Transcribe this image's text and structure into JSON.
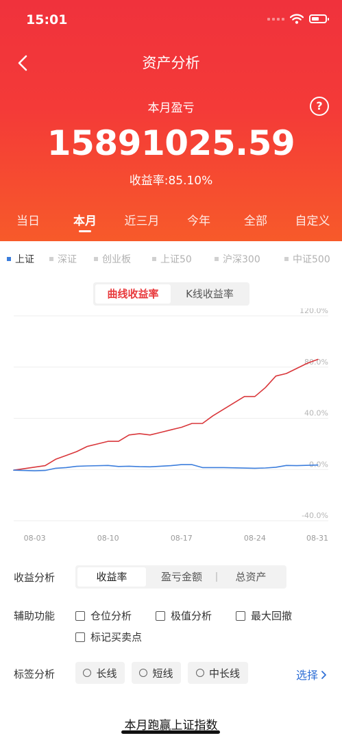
{
  "status_bar": {
    "time": "15:01"
  },
  "header": {
    "title": "资产分析"
  },
  "summary": {
    "label": "本月盈亏",
    "amount": "15891025.59",
    "rate_label": "收益率:",
    "rate_value": "85.10%",
    "help_glyph": "?"
  },
  "periods": [
    {
      "label": "当日",
      "active": false
    },
    {
      "label": "本月",
      "active": true
    },
    {
      "label": "近三月",
      "active": false
    },
    {
      "label": "今年",
      "active": false
    },
    {
      "label": "全部",
      "active": false
    },
    {
      "label": "自定义",
      "active": false
    }
  ],
  "indices": [
    {
      "label": "上证",
      "active": true
    },
    {
      "label": "深证",
      "active": false
    },
    {
      "label": "创业板",
      "active": false
    },
    {
      "label": "上证50",
      "active": false
    },
    {
      "label": "沪深300",
      "active": false
    },
    {
      "label": "中证500",
      "active": false
    }
  ],
  "chart_toggle": {
    "options": [
      "曲线收益率",
      "K线收益率"
    ],
    "selected": 0
  },
  "chart_data": {
    "type": "line",
    "x_ticks": [
      "08-03",
      "08-10",
      "08-17",
      "08-24",
      "08-31"
    ],
    "y_ticks": [
      "120.0%",
      "80.0%",
      "40.0%",
      "0.0%",
      "-40.0%"
    ],
    "ylim": [
      -40,
      120
    ],
    "series": [
      {
        "color": "#d9363a",
        "points": [
          [
            "08-01",
            -0.5
          ],
          [
            "08-04",
            3
          ],
          [
            "08-05",
            8
          ],
          [
            "08-06",
            11
          ],
          [
            "08-07",
            14
          ],
          [
            "08-08",
            18
          ],
          [
            "08-09",
            20
          ],
          [
            "08-10",
            22
          ],
          [
            "08-11",
            22
          ],
          [
            "08-12",
            27
          ],
          [
            "08-13",
            28
          ],
          [
            "08-14",
            27
          ],
          [
            "08-15",
            29
          ],
          [
            "08-16",
            31
          ],
          [
            "08-17",
            33
          ],
          [
            "08-18",
            36
          ],
          [
            "08-19",
            36
          ],
          [
            "08-20",
            42
          ],
          [
            "08-21",
            47
          ],
          [
            "08-22",
            52
          ],
          [
            "08-23",
            57
          ],
          [
            "08-24",
            57
          ],
          [
            "08-25",
            64
          ],
          [
            "08-26",
            73
          ],
          [
            "08-27",
            75
          ],
          [
            "08-28",
            79
          ],
          [
            "08-29",
            83
          ],
          [
            "08-30",
            86
          ]
        ]
      },
      {
        "color": "#3b7ddc",
        "points": [
          [
            "08-01",
            -0.5
          ],
          [
            "08-03",
            -1
          ],
          [
            "08-04",
            -0.7
          ],
          [
            "08-05",
            1
          ],
          [
            "08-06",
            1.5
          ],
          [
            "08-07",
            2.5
          ],
          [
            "08-08",
            2.8
          ],
          [
            "08-10",
            3.2
          ],
          [
            "08-11",
            2.4
          ],
          [
            "08-12",
            2.6
          ],
          [
            "08-13",
            2.2
          ],
          [
            "08-14",
            2.1
          ],
          [
            "08-16",
            3
          ],
          [
            "08-17",
            3.8
          ],
          [
            "08-18",
            3.8
          ],
          [
            "08-19",
            1.5
          ],
          [
            "08-21",
            1.5
          ],
          [
            "08-24",
            1
          ],
          [
            "08-25",
            1.2
          ],
          [
            "08-26",
            1.8
          ],
          [
            "08-27",
            3.2
          ],
          [
            "08-28",
            3
          ],
          [
            "08-30",
            3.5
          ]
        ]
      }
    ]
  },
  "analysis": {
    "label": "收益分析",
    "options": [
      "收益率",
      "盈亏金额",
      "总资产"
    ],
    "selected": 0
  },
  "aux": {
    "label": "辅助功能",
    "items": [
      "仓位分析",
      "极值分析",
      "最大回撤",
      "标记买卖点"
    ]
  },
  "tags": {
    "label": "标签分析",
    "items": [
      "长线",
      "短线",
      "中长线"
    ],
    "select_label": "选择"
  },
  "footer": {
    "text": "本月跑赢上证指数"
  },
  "colors": {
    "accent": "#e8383b",
    "link": "#2f6fd6"
  }
}
